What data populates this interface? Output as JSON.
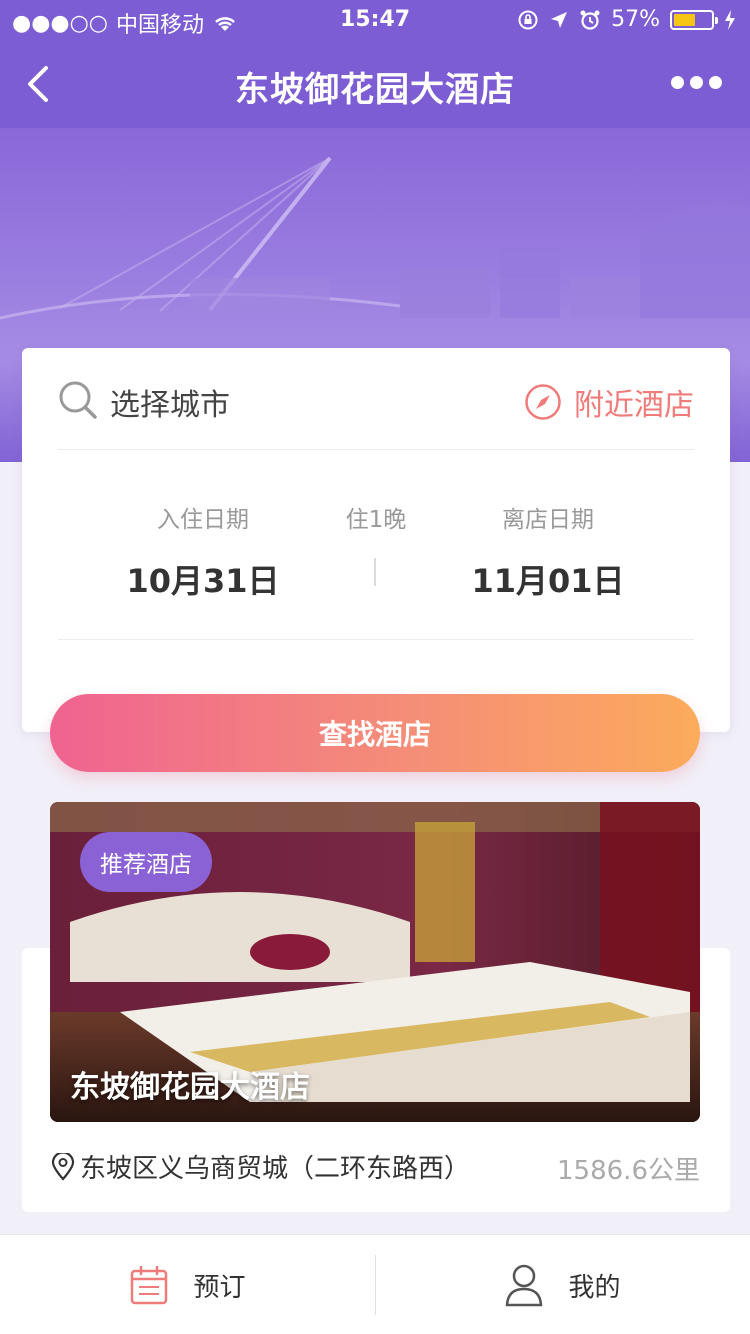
{
  "status_bar": {
    "signal": "●●●○○",
    "carrier": "中国移动",
    "time": "15:47",
    "battery": "57%",
    "battery_level": 0.57
  },
  "navbar": {
    "title": "东坡御花园大酒店",
    "back_icon": "chevron-left-icon",
    "more_icon": "more-dots-icon"
  },
  "search": {
    "city_placeholder": "选择城市",
    "nearby_label": "附近酒店",
    "checkin_label": "入住日期",
    "checkin_date": "10月31日",
    "nights_label": "住1晚",
    "checkout_label": "离店日期",
    "checkout_date": "11月01日",
    "find_button": "查找酒店"
  },
  "recommend": {
    "tag": "推荐酒店",
    "hotel_name": "东坡御花园大酒店",
    "address": "东坡区义乌商贸城（二环东路西）",
    "distance": "1586.6公里"
  },
  "tabbar": {
    "items": [
      {
        "label": "预订",
        "icon": "calendar-icon"
      },
      {
        "label": "我的",
        "icon": "user-icon"
      }
    ]
  },
  "colors": {
    "brand": "#7c5dd3",
    "accent_coral": "#f07b7b",
    "button_gradient_start": "#f06391",
    "button_gradient_end": "#fcab5c"
  }
}
